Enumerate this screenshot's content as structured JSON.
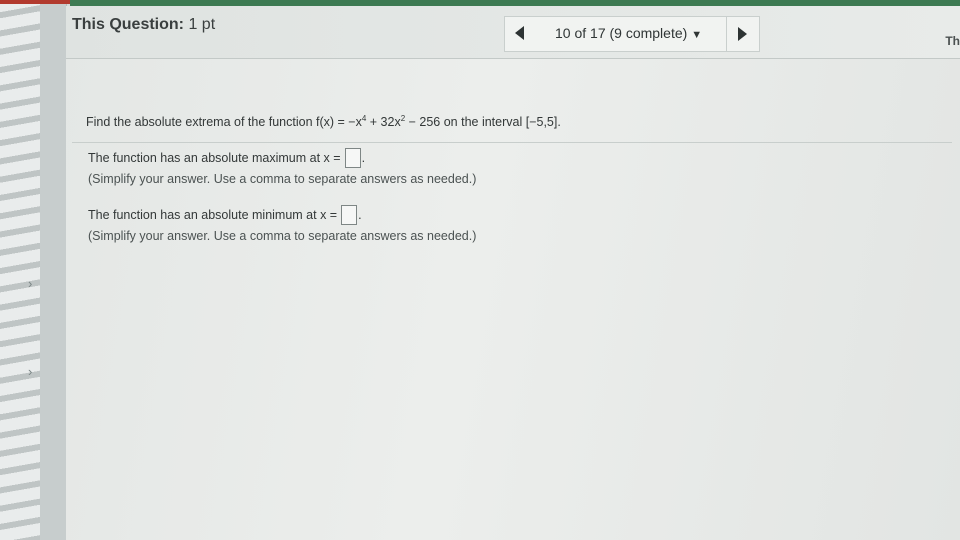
{
  "header": {
    "question_label": "This Question:",
    "points": "1 pt",
    "progress_text": "10 of 17 (9 complete)",
    "corner_text": "Th"
  },
  "icons": {
    "prev": "triangle-left-icon",
    "next": "triangle-right-icon",
    "dropdown": "triangle-down-icon",
    "sidebar_chevron": "chevron-right-icon"
  },
  "problem": {
    "prefix": "Find the absolute extrema of the function f(x) = −x",
    "exp1": "4",
    "mid": " + 32x",
    "exp2": "2",
    "suffix": " − 256 on the interval [−5,5]."
  },
  "answers": [
    {
      "label": "The function has an absolute maximum at x =",
      "value": "",
      "hint": "(Simplify your answer. Use a comma to separate answers as needed.)"
    },
    {
      "label": "The function has an absolute minimum at x =",
      "value": "",
      "hint": "(Simplify your answer. Use a comma to separate answers as needed.)"
    }
  ],
  "colors": {
    "top_bar": "#3d7a52",
    "accent_red": "#b23a2e"
  }
}
